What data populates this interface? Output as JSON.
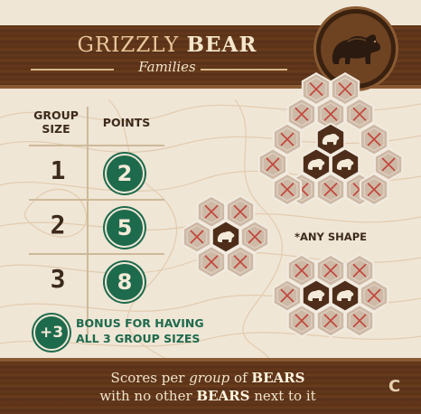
{
  "card": {
    "title_part1": "GRIZZLY ",
    "title_part2": "BEAR",
    "subtitle": "Families",
    "corner_letter": "C"
  },
  "medallion": {
    "icon": "grizzly-bear-icon"
  },
  "scoring_table": {
    "header_group_size": "GROUP\nSIZE",
    "header_points": "POINTS",
    "rows": [
      {
        "size": "1",
        "points": "2"
      },
      {
        "size": "2",
        "points": "5"
      },
      {
        "size": "3",
        "points": "8"
      }
    ]
  },
  "bonus": {
    "badge": "+3",
    "text_line1": "BONUS FOR HAVING",
    "text_line2": "ALL 3 GROUP SIZES"
  },
  "examples": {
    "any_shape_note": "*ANY SHAPE",
    "bear_tile_icon": "bear-silhouette-icon",
    "blocked_tile_icon": "red-x-icon"
  },
  "footer": {
    "line1_prefix": "Scores per ",
    "line1_italic": "group",
    "line1_mid": " of ",
    "line1_bold": "BEARS",
    "line2_prefix": "with no other ",
    "line2_bold": "BEARS",
    "line2_suffix": " next to it"
  },
  "colors": {
    "wood": "#5a3217",
    "parchment": "#efe6d6",
    "green_badge": "#1e6a4c",
    "bear_tile": "#4e2e1a",
    "blocked_tile": "#cdb9a6",
    "x_mark": "#c2453b",
    "title_gold": "#e8c79b"
  }
}
